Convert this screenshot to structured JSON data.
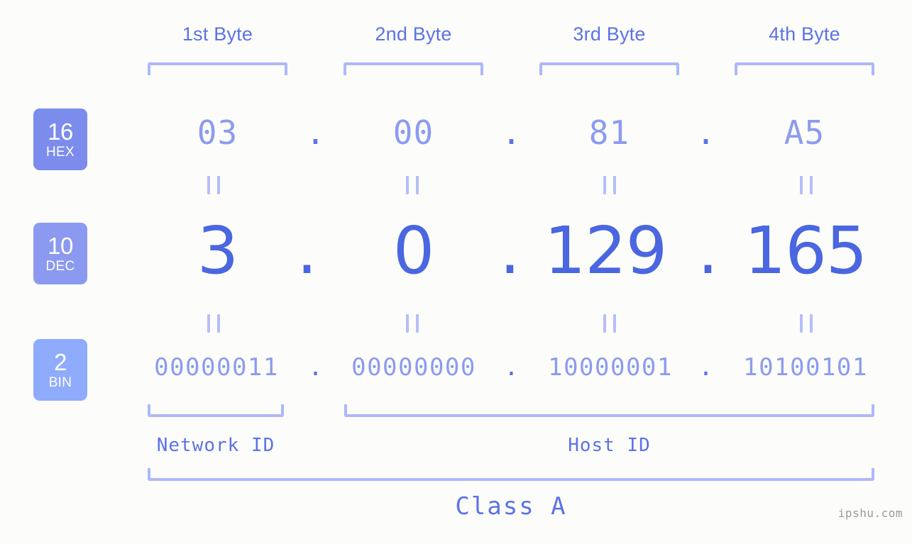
{
  "watermark": "ipshu.com",
  "byte_headers": [
    {
      "label": "1st Byte"
    },
    {
      "label": "2nd Byte"
    },
    {
      "label": "3rd Byte"
    },
    {
      "label": "4th Byte"
    }
  ],
  "radix_badges": [
    {
      "number": "16",
      "name": "HEX",
      "color": "#7b8ced"
    },
    {
      "number": "10",
      "name": "DEC",
      "color": "#8b99f0"
    },
    {
      "number": "2",
      "name": "BIN",
      "color": "#8fabfc"
    }
  ],
  "rows": {
    "hex": {
      "radix": "16",
      "radix_name": "HEX",
      "values": [
        "03",
        "00",
        "81",
        "A5"
      ],
      "separator": "."
    },
    "dec": {
      "radix": "10",
      "radix_name": "DEC",
      "values": [
        "3",
        "0",
        "129",
        "165"
      ],
      "separator": "."
    },
    "bin": {
      "radix": "2",
      "radix_name": "BIN",
      "values": [
        "00000011",
        "00000000",
        "10000001",
        "10100101"
      ],
      "separator": "."
    }
  },
  "equals_mark": "=",
  "segments": {
    "network_id": "Network ID",
    "host_id": "Host ID",
    "class": "Class A"
  },
  "colors": {
    "background": "#fcfdfa",
    "header_text": "#5c72e8",
    "bracket": "#aeb8f9",
    "hex_text": "#8c9bf0",
    "dec_text": "#4a66e0",
    "bin_text": "#8c9bf0",
    "equals": "#b5bef9",
    "watermark": "#9a9a9a"
  },
  "ip_address": "3.0.129.165"
}
